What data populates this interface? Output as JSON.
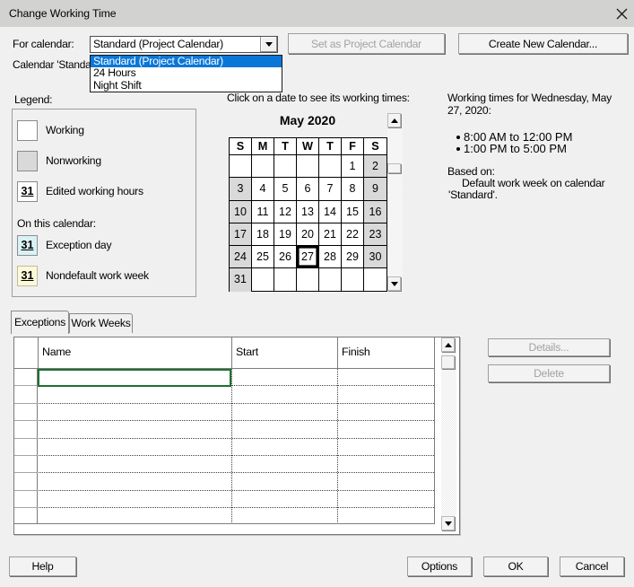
{
  "window": {
    "title": "Change Working Time",
    "close_icon": "x"
  },
  "colors": {
    "dialog_bg": "#f0f0f0",
    "titlebar_bg": "#d2d2d0",
    "selection_blue": "#0a77d8",
    "selection_green": "#1e7131",
    "nonworking_gray": "#d9d9d9",
    "exception_cyan": "#d9f2f4",
    "nondefault_yellow": "#fcf8da"
  },
  "calendar_picker": {
    "for_calendar_label": "For calendar:",
    "combo_value": "Standard (Project Calendar)",
    "dropdown_items": [
      {
        "label": "Standard (Project Calendar)",
        "selected": true
      },
      {
        "label": "24 Hours",
        "selected": false
      },
      {
        "label": "Night Shift",
        "selected": false
      }
    ],
    "set_as_project_button": "Set as Project Calendar",
    "create_new_button": "Create New Calendar...",
    "calendar_note_clipped": "Calendar 'Standa"
  },
  "legend": {
    "label": "Legend:",
    "items": [
      {
        "kind": "working",
        "swatch_text": "",
        "label": "Working"
      },
      {
        "kind": "nonworking",
        "swatch_text": "",
        "label": "Nonworking"
      },
      {
        "kind": "edited",
        "swatch_text": "31",
        "label": "Edited working hours"
      }
    ],
    "on_this_calendar_label": "On this calendar:",
    "calendar_items": [
      {
        "kind": "exception",
        "swatch_text": "31",
        "label": "Exception day"
      },
      {
        "kind": "nondefault",
        "swatch_text": "31",
        "label": "Nondefault work week"
      }
    ]
  },
  "calendar": {
    "hint": "Click on a date to see its working times:",
    "month_title": "May 2020",
    "day_headers": [
      "S",
      "M",
      "T",
      "W",
      "T",
      "F",
      "S"
    ],
    "weeks": [
      [
        "",
        "",
        "",
        "",
        "",
        "1",
        "2"
      ],
      [
        "3",
        "4",
        "5",
        "6",
        "7",
        "8",
        "9"
      ],
      [
        "10",
        "11",
        "12",
        "13",
        "14",
        "15",
        "16"
      ],
      [
        "17",
        "18",
        "19",
        "20",
        "21",
        "22",
        "23"
      ],
      [
        "24",
        "25",
        "26",
        "27",
        "28",
        "29",
        "30"
      ],
      [
        "31",
        "",
        "",
        "",
        "",
        "",
        ""
      ]
    ],
    "selected_date": "27"
  },
  "working_times": {
    "title_line1": "Working times for Wednesday, May",
    "title_line2": "27, 2020:",
    "times": [
      "8:00 AM to 12:00 PM",
      "1:00 PM to 5:00 PM"
    ],
    "based_on_label": "Based on:",
    "based_on_line1": "Default work week on calendar",
    "based_on_line2": "'Standard'."
  },
  "tabs": [
    {
      "label": "Exceptions",
      "active": true
    },
    {
      "label": "Work Weeks",
      "active": false
    }
  ],
  "exceptions_table": {
    "columns": [
      "Name",
      "Start",
      "Finish"
    ],
    "row_count": 9,
    "rows": [
      [
        "",
        "",
        ""
      ],
      [
        "",
        "",
        ""
      ],
      [
        "",
        "",
        ""
      ],
      [
        "",
        "",
        ""
      ],
      [
        "",
        "",
        ""
      ],
      [
        "",
        "",
        ""
      ],
      [
        "",
        "",
        ""
      ],
      [
        "",
        "",
        ""
      ],
      [
        "",
        "",
        ""
      ]
    ],
    "selected_cell": {
      "row": 1,
      "column": "Name"
    }
  },
  "side_buttons": {
    "details": "Details...",
    "delete": "Delete"
  },
  "footer": {
    "help": "Help",
    "options": "Options",
    "ok": "OK",
    "cancel": "Cancel"
  }
}
